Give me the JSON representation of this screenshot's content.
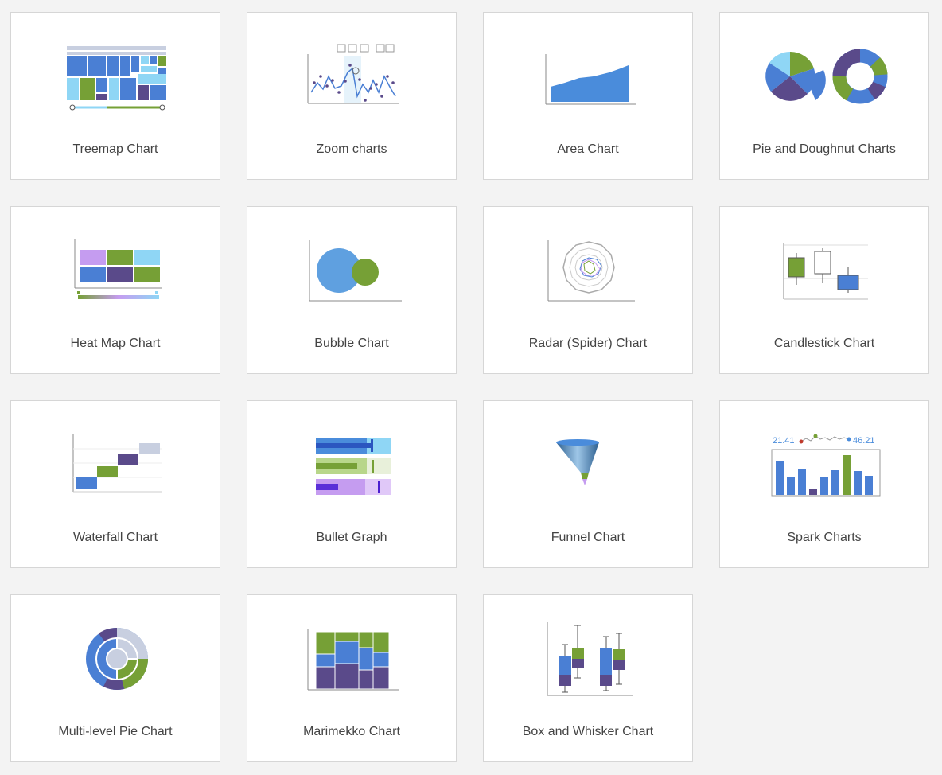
{
  "colors": {
    "blue": "#4a7fd4",
    "green": "#76a036",
    "purple": "#5a4a8a",
    "lightblue": "#8fd6f5",
    "lavender": "#c59cf0",
    "gray": "#c8cfe0"
  },
  "cards": [
    {
      "label": "Treemap Chart",
      "icon": "treemap-chart-icon"
    },
    {
      "label": "Zoom charts",
      "icon": "zoom-chart-icon"
    },
    {
      "label": "Area Chart",
      "icon": "area-chart-icon"
    },
    {
      "label": "Pie and Doughnut Charts",
      "icon": "pie-doughnut-chart-icon"
    },
    {
      "label": "Heat Map Chart",
      "icon": "heat-map-chart-icon"
    },
    {
      "label": "Bubble Chart",
      "icon": "bubble-chart-icon"
    },
    {
      "label": "Radar (Spider) Chart",
      "icon": "radar-chart-icon"
    },
    {
      "label": "Candlestick Chart",
      "icon": "candlestick-chart-icon"
    },
    {
      "label": "Waterfall Chart",
      "icon": "waterfall-chart-icon"
    },
    {
      "label": "Bullet Graph",
      "icon": "bullet-graph-icon"
    },
    {
      "label": "Funnel Chart",
      "icon": "funnel-chart-icon"
    },
    {
      "label": "Spark Charts",
      "icon": "spark-chart-icon",
      "values": [
        "21.41",
        "46.21"
      ]
    },
    {
      "label": "Multi-level Pie Chart",
      "icon": "multi-level-pie-chart-icon"
    },
    {
      "label": "Marimekko Chart",
      "icon": "marimekko-chart-icon"
    },
    {
      "label": "Box and Whisker Chart",
      "icon": "box-whisker-chart-icon"
    }
  ]
}
